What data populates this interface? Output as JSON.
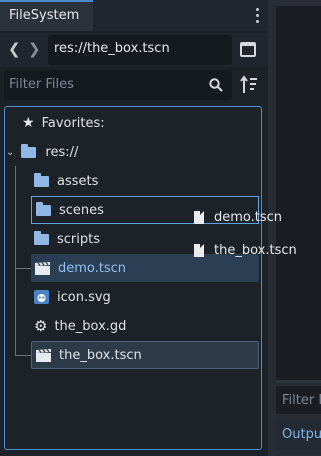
{
  "dock": {
    "tab_label": "FileSystem",
    "path_value": "res://the_box.tscn",
    "filter_placeholder": "Filter Files"
  },
  "tree": {
    "favorites_label": "Favorites:",
    "root_label": "res://",
    "items": [
      {
        "label": "assets",
        "icon": "folder-icon"
      },
      {
        "label": "scenes",
        "icon": "folder-icon"
      },
      {
        "label": "scripts",
        "icon": "folder-icon"
      },
      {
        "label": "demo.tscn",
        "icon": "scene-clapper-icon"
      },
      {
        "label": "icon.svg",
        "icon": "godot-image-icon"
      },
      {
        "label": "the_box.gd",
        "icon": "gear-script-icon"
      },
      {
        "label": "the_box.tscn",
        "icon": "scene-clapper-icon"
      }
    ]
  },
  "drag_preview": {
    "items": [
      "demo.tscn",
      "the_box.tscn"
    ]
  },
  "right_panel": {
    "filter_stub": "Filter M",
    "output_stub": "Outpu"
  },
  "colors": {
    "accent": "#4c8fd6",
    "folder": "#8fb8e6",
    "highlight_text": "#8fc0f0"
  }
}
